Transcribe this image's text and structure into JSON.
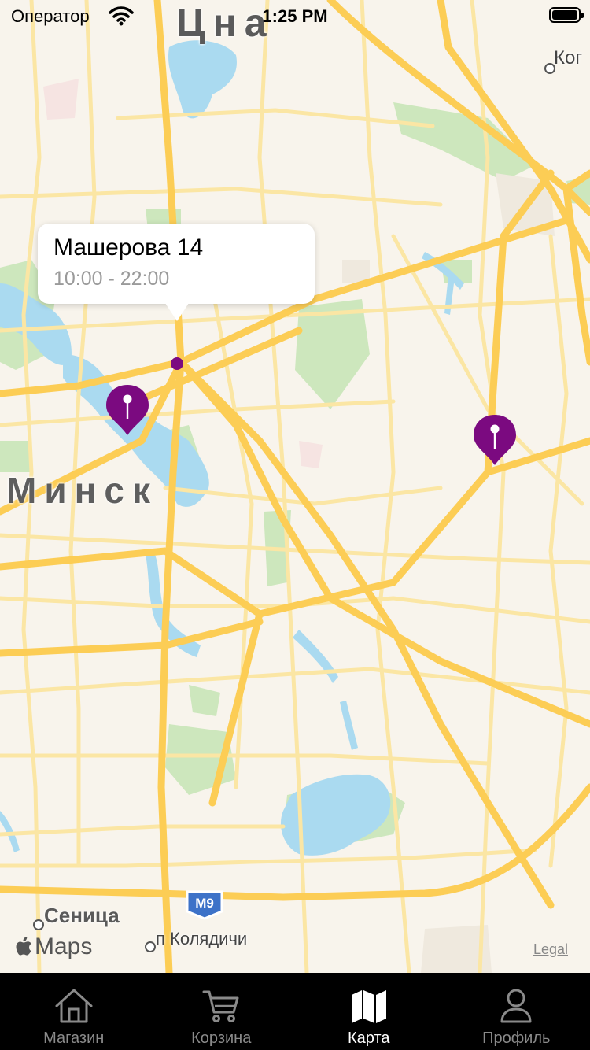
{
  "status_bar": {
    "carrier": "Оператор",
    "time": "1:25 PM"
  },
  "map": {
    "city_labels": [
      "Минск",
      "Цна"
    ],
    "poi_labels": [
      "Сеница",
      "п Колядичи",
      "Ког"
    ],
    "highway_shield": "M9",
    "attribution": "Maps",
    "legal": "Legal",
    "colors": {
      "land": "#f8f4ec",
      "water": "#aadaf0",
      "park": "#cde7bd",
      "major_road": "#fccd55",
      "minor_road": "#fbe6a4",
      "pin": "#7b0a80"
    }
  },
  "callout": {
    "title": "Машерова 14",
    "hours": "10:00 - 22:00"
  },
  "store_pins": [
    "store-pin-center",
    "store-pin-east"
  ],
  "tab_bar": {
    "tabs": [
      {
        "label": "Магазин",
        "icon": "house-icon",
        "active": false
      },
      {
        "label": "Корзина",
        "icon": "cart-icon",
        "active": false
      },
      {
        "label": "Карта",
        "icon": "map-icon",
        "active": true
      },
      {
        "label": "Профиль",
        "icon": "person-icon",
        "active": false
      }
    ]
  }
}
